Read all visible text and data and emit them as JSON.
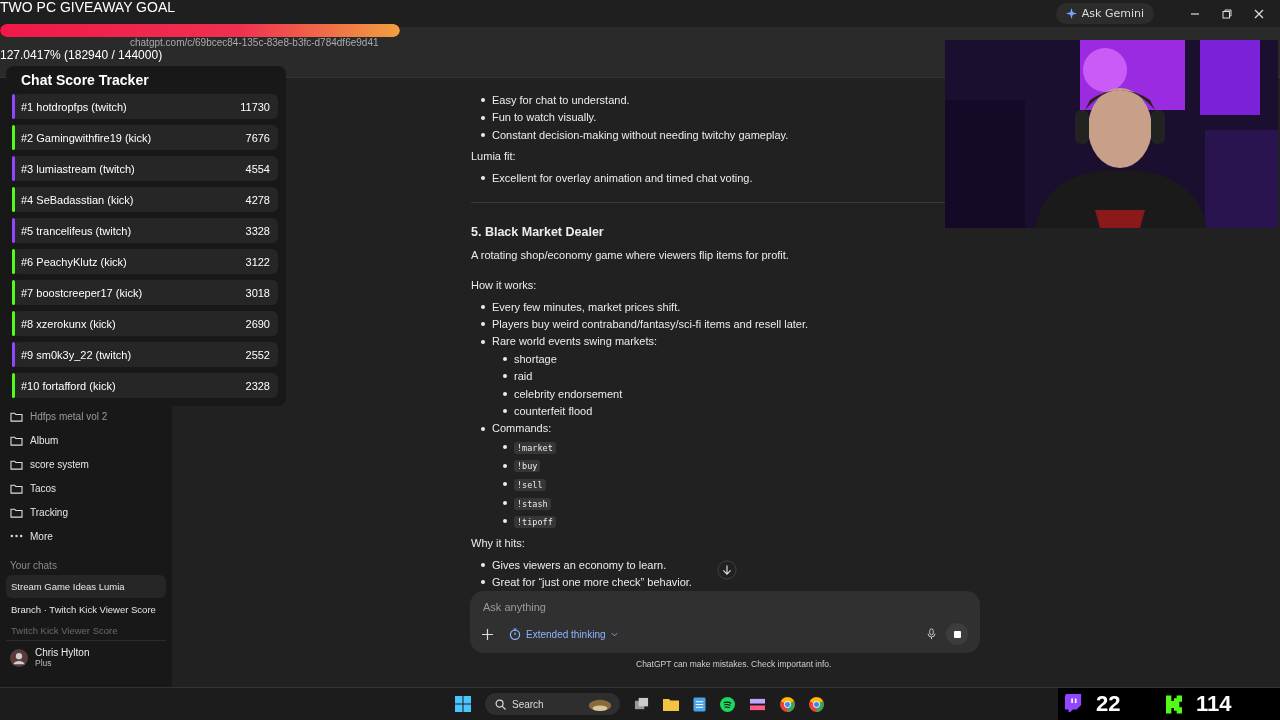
{
  "browser": {
    "address": "chatgpt.com/c/69bcec84-135c-83e8-b3fc-d784df6e9d41",
    "gemini_button": "Ask Gemini"
  },
  "sidebar": {
    "projects": [
      {
        "label": "Hdfps metal vol 2",
        "kind": "folder"
      },
      {
        "label": "Album",
        "kind": "folder"
      },
      {
        "label": "score system",
        "kind": "folder"
      },
      {
        "label": "Tacos",
        "kind": "folder"
      },
      {
        "label": "Tracking",
        "kind": "folder"
      },
      {
        "label": "More",
        "kind": "more"
      }
    ],
    "chats_heading": "Your chats",
    "chats": [
      {
        "label": "Stream Game Ideas Lumia",
        "selected": true
      },
      {
        "label": "Branch · Twitch Kick Viewer Score",
        "selected": false
      },
      {
        "label": "Twitch Kick Viewer Score",
        "selected": false
      }
    ],
    "user": {
      "name": "Chris Hylton",
      "plan": "Plus"
    }
  },
  "content": {
    "blocks": [
      {
        "kind": "bullets",
        "items": [
          {
            "text": "Easy for chat to understand."
          },
          {
            "text": "Fun to watch visually."
          },
          {
            "text": "Constant decision-making without needing twitchy gameplay."
          }
        ]
      },
      {
        "kind": "label",
        "text": "Lumia fit:"
      },
      {
        "kind": "bullets",
        "items": [
          {
            "text": "Excellent for overlay animation and timed chat voting."
          }
        ]
      },
      {
        "kind": "rule"
      },
      {
        "kind": "heading",
        "text": "5. Black Market Dealer"
      },
      {
        "kind": "paragraph",
        "text": "A rotating shop/economy game where viewers flip items for profit."
      },
      {
        "kind": "label",
        "text": "How it works:"
      },
      {
        "kind": "bullets",
        "items": [
          {
            "text": "Every few minutes, market prices shift."
          },
          {
            "text": "Players buy weird contraband/fantasy/sci-fi items and resell later."
          },
          {
            "text": "Rare world events swing markets:",
            "children": [
              {
                "text": "shortage"
              },
              {
                "text": "raid"
              },
              {
                "text": "celebrity endorsement"
              },
              {
                "text": "counterfeit flood"
              }
            ]
          },
          {
            "text": "Commands:",
            "code_children": [
              "!market",
              "!buy",
              "!sell",
              "!stash",
              "!tipoff"
            ]
          }
        ]
      },
      {
        "kind": "label",
        "text": "Why it hits:"
      },
      {
        "kind": "bullets",
        "items": [
          {
            "text": "Gives viewers an economy to learn."
          },
          {
            "text": "Great for “just one more check” behavior."
          }
        ]
      }
    ],
    "composer": {
      "placeholder": "Ask anything",
      "mode": "Extended thinking"
    },
    "disclaimer": "ChatGPT can make mistakes. Check important info."
  },
  "taskbar": {
    "search": "Search"
  },
  "goal": {
    "title": "TWO PC GIVEAWAY GOAL",
    "level": 1,
    "progress": "127.0417% (182940 / 144000)"
  },
  "tracker": {
    "title": "Chat Score Tracker",
    "rows": [
      {
        "label": "#1 hotdropfps (twitch)",
        "score": "11730",
        "color": "#9146ff"
      },
      {
        "label": "#2 Gamingwithfire19 (kick)",
        "score": "7676",
        "color": "#53fc18"
      },
      {
        "label": "#3 lumiastream (twitch)",
        "score": "4554",
        "color": "#9146ff"
      },
      {
        "label": "#4 SeBadasstian (kick)",
        "score": "4278",
        "color": "#53fc18"
      },
      {
        "label": "#5 trancelifeus (twitch)",
        "score": "3328",
        "color": "#9146ff"
      },
      {
        "label": "#6 PeachyKlutz (kick)",
        "score": "3122",
        "color": "#53fc18"
      },
      {
        "label": "#7 boostcreeper17 (kick)",
        "score": "3018",
        "color": "#53fc18"
      },
      {
        "label": "#8 xzerokunx (kick)",
        "score": "2690",
        "color": "#53fc18"
      },
      {
        "label": "#9 sm0k3y_22 (twitch)",
        "score": "2552",
        "color": "#9146ff"
      },
      {
        "label": "#10 fortafford (kick)",
        "score": "2328",
        "color": "#53fc18"
      }
    ]
  },
  "counters": {
    "twitch": "22",
    "kick": "114"
  }
}
